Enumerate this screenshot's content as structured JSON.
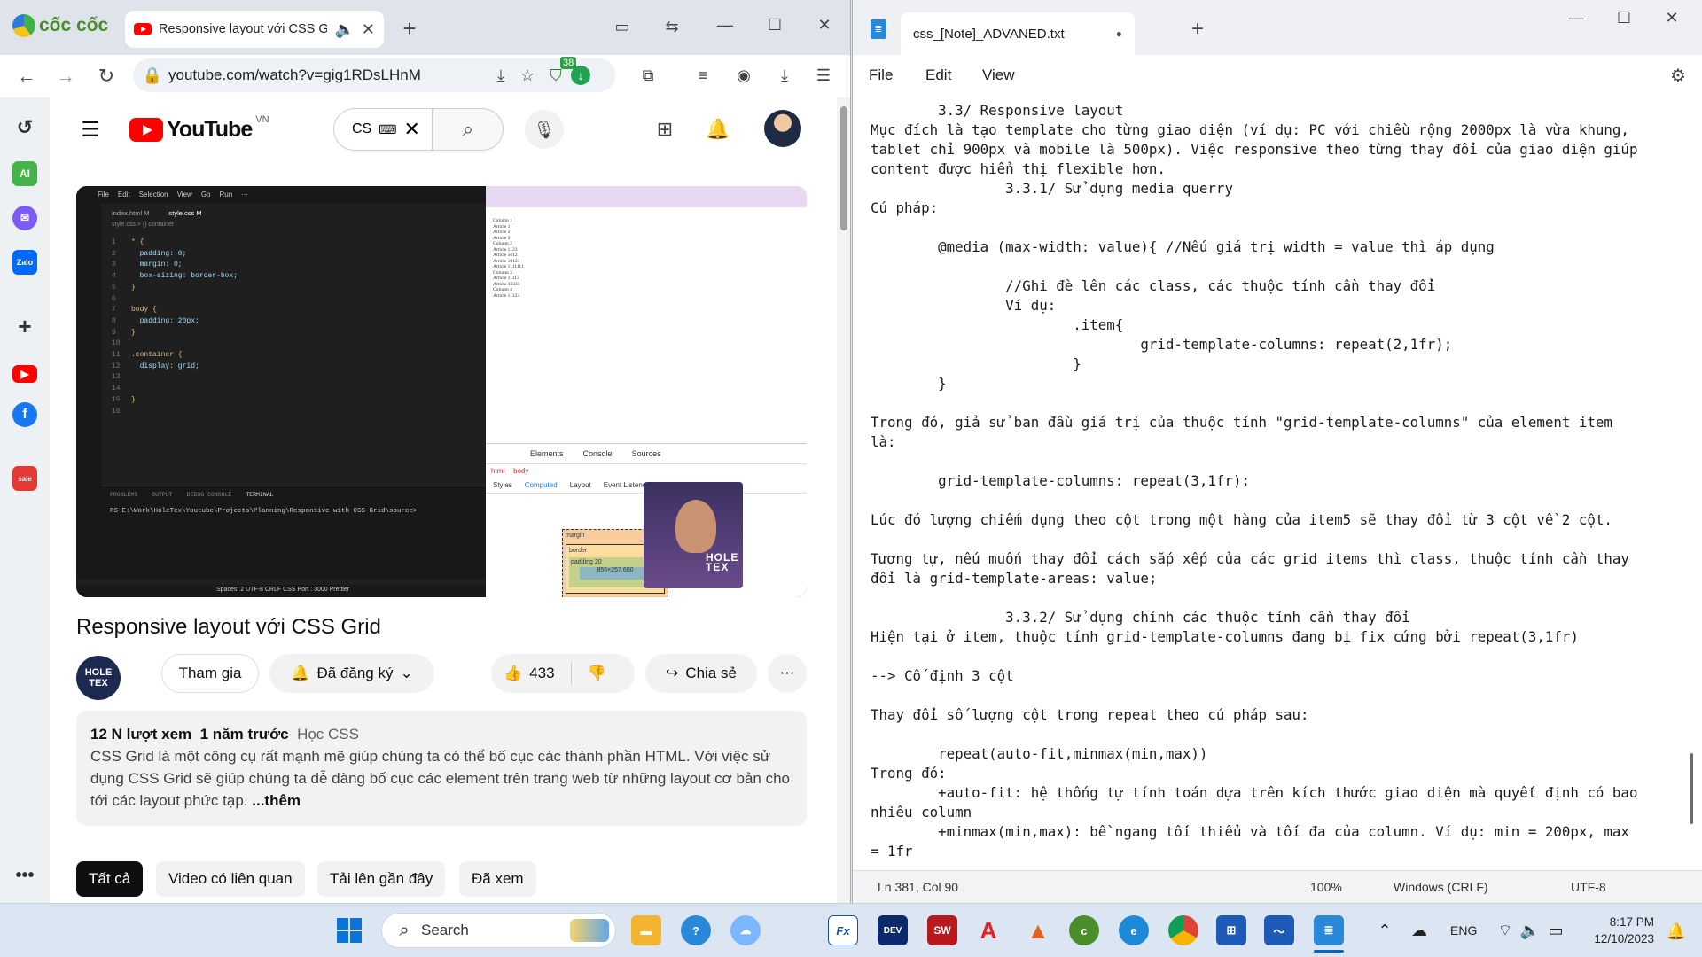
{
  "browser": {
    "brand": "cốc cốc",
    "tab_title": "Responsive layout với CSS Grid",
    "url": "youtube.com/watch?v=gig1RDsLHnM",
    "badge_count": "38"
  },
  "youtube": {
    "logo_text": "YouTube",
    "region": "VN",
    "search_value": "CS",
    "video": {
      "vscode_menu": [
        "File",
        "Edit",
        "Selection",
        "View",
        "Go",
        "Run",
        "···"
      ],
      "vscode_tabs": [
        "index.html M",
        "style.css M"
      ],
      "breadcrumb": "style.css > {} container",
      "code_lines": [
        {
          "n": "1",
          "t": "* {"
        },
        {
          "n": "2",
          "t": "  padding: 0;"
        },
        {
          "n": "3",
          "t": "  margin: 0;"
        },
        {
          "n": "4",
          "t": "  box-sizing: border-box;"
        },
        {
          "n": "5",
          "t": "}"
        },
        {
          "n": "6",
          "t": ""
        },
        {
          "n": "7",
          "t": "body {"
        },
        {
          "n": "8",
          "t": "  padding: 20px;"
        },
        {
          "n": "9",
          "t": "}"
        },
        {
          "n": "10",
          "t": ""
        },
        {
          "n": "11",
          "t": ".container {"
        },
        {
          "n": "12",
          "t": "  display: grid;"
        },
        {
          "n": "13",
          "t": ""
        },
        {
          "n": "14",
          "t": ""
        },
        {
          "n": "15",
          "t": "}"
        },
        {
          "n": "16",
          "t": ""
        }
      ],
      "terminal_tabs": [
        "PROBLEMS",
        "OUTPUT",
        "DEBUG CONSOLE",
        "TERMINAL"
      ],
      "terminal_line": "PS E:\\Work\\HoleTex\\Youtube\\Projects\\Planning\\Responsive with CSS Grid\\source>",
      "status_items": "Spaces: 2   UTF-8   CRLF   CSS   Port : 3000   Prettier",
      "page_list": [
        "Column 1",
        "Article 1",
        "Article 2",
        "Article 3",
        "Column 2",
        "Article 1123",
        "Article 5612",
        "Article 10123",
        "Article 1111111",
        "Column 3",
        "Article 11113",
        "Article 33333",
        "Column 4",
        "Article 11123"
      ],
      "devtools_tabs": [
        "Elements",
        "Console",
        "Sources"
      ],
      "devtools_sub": [
        "Styles",
        "Computed",
        "Layout",
        "Event Listeners"
      ],
      "devtools_crumb": [
        "html",
        "body"
      ],
      "box_labels": [
        "margin",
        "border",
        "padding 20",
        "856×257.600"
      ]
    },
    "title": "Responsive layout với CSS Grid",
    "channel_logo": "HOLE TEX",
    "join_label": "Tham gia",
    "subscribed_label": "Đã đăng ký",
    "likes": "433",
    "share_label": "Chia sẻ",
    "description": {
      "views": "12 N lượt xem",
      "date": "1 năm trước",
      "tag": "Học CSS",
      "text": "CSS Grid là một công cụ rất mạnh mẽ giúp chúng ta có thể bố cục các thành phần HTML. Với việc sử dụng CSS Grid sẽ giúp chúng ta dễ dàng bố cục các element trên trang web từ những layout cơ bản cho tới các layout phức tạp.",
      "more": "...thêm"
    },
    "chips": [
      "Tất cả",
      "Video có liên quan",
      "Tải lên gần đây",
      "Đã xem"
    ]
  },
  "notepad": {
    "tab_title": "css_[Note]_ADVANED.txt",
    "menu": [
      "File",
      "Edit",
      "View"
    ],
    "text": "        3.3/ Responsive layout\nMục đích là tạo template cho từng giao diện (ví dụ: PC với chiều rộng 2000px là vừa khung,\ntablet chỉ 900px và mobile là 500px). Việc responsive theo từng thay đổi của giao diện giúp\ncontent được hiển thị flexible hơn.\n                3.3.1/ Sử dụng media querry\nCú pháp:\n\n        @media (max-width: value){ //Nếu giá trị width = value thì áp dụng\n\n                //Ghi đè lên các class, các thuộc tính cần thay đổi\n                Ví dụ:\n                        .item{\n                                grid-template-columns: repeat(2,1fr);\n                        }\n        }\n\nTrong đó, giả sử ban đầu giá trị của thuộc tính \"grid-template-columns\" của element item\nlà:\n\n        grid-template-columns: repeat(3,1fr);\n\nLúc đó lượng chiếm dụng theo cột trong một hàng của item5 sẽ thay đổi từ 3 cột về 2 cột.\n\nTương tự, nếu muốn thay đổi cách sắp xếp của các grid items thì class, thuộc tính cần thay\nđổi là grid-template-areas: value;\n\n                3.3.2/ Sử dụng chính các thuộc tính cần thay đổi\nHiện tại ở item, thuộc tính grid-template-columns đang bị fix cứng bởi repeat(3,1fr)\n\n--> Cố định 3 cột\n\nThay đổi số lượng cột trong repeat theo cú pháp sau:\n\n        repeat(auto-fit,minmax(min,max))\nTrong đó:\n        +auto-fit: hệ thống tự tính toán dựa trên kích thước giao diện mà quyết định có bao\nnhiêu column\n        +minmax(min,max): bề ngang tối thiểu và tối đa của column. Ví dụ: min = 200px, max\n= 1fr",
    "status": {
      "position": "Ln 381, Col 90",
      "zoom": "100%",
      "line_ending": "Windows (CRLF)",
      "encoding": "UTF-8"
    }
  },
  "taskbar": {
    "search_placeholder": "Search",
    "language": "ENG",
    "time": "8:17 PM",
    "date": "12/10/2023"
  },
  "colors": {
    "youtube_red": "#ff0000",
    "accent_blue": "#0067c0",
    "coccoc_green": "#4a8d2b"
  }
}
